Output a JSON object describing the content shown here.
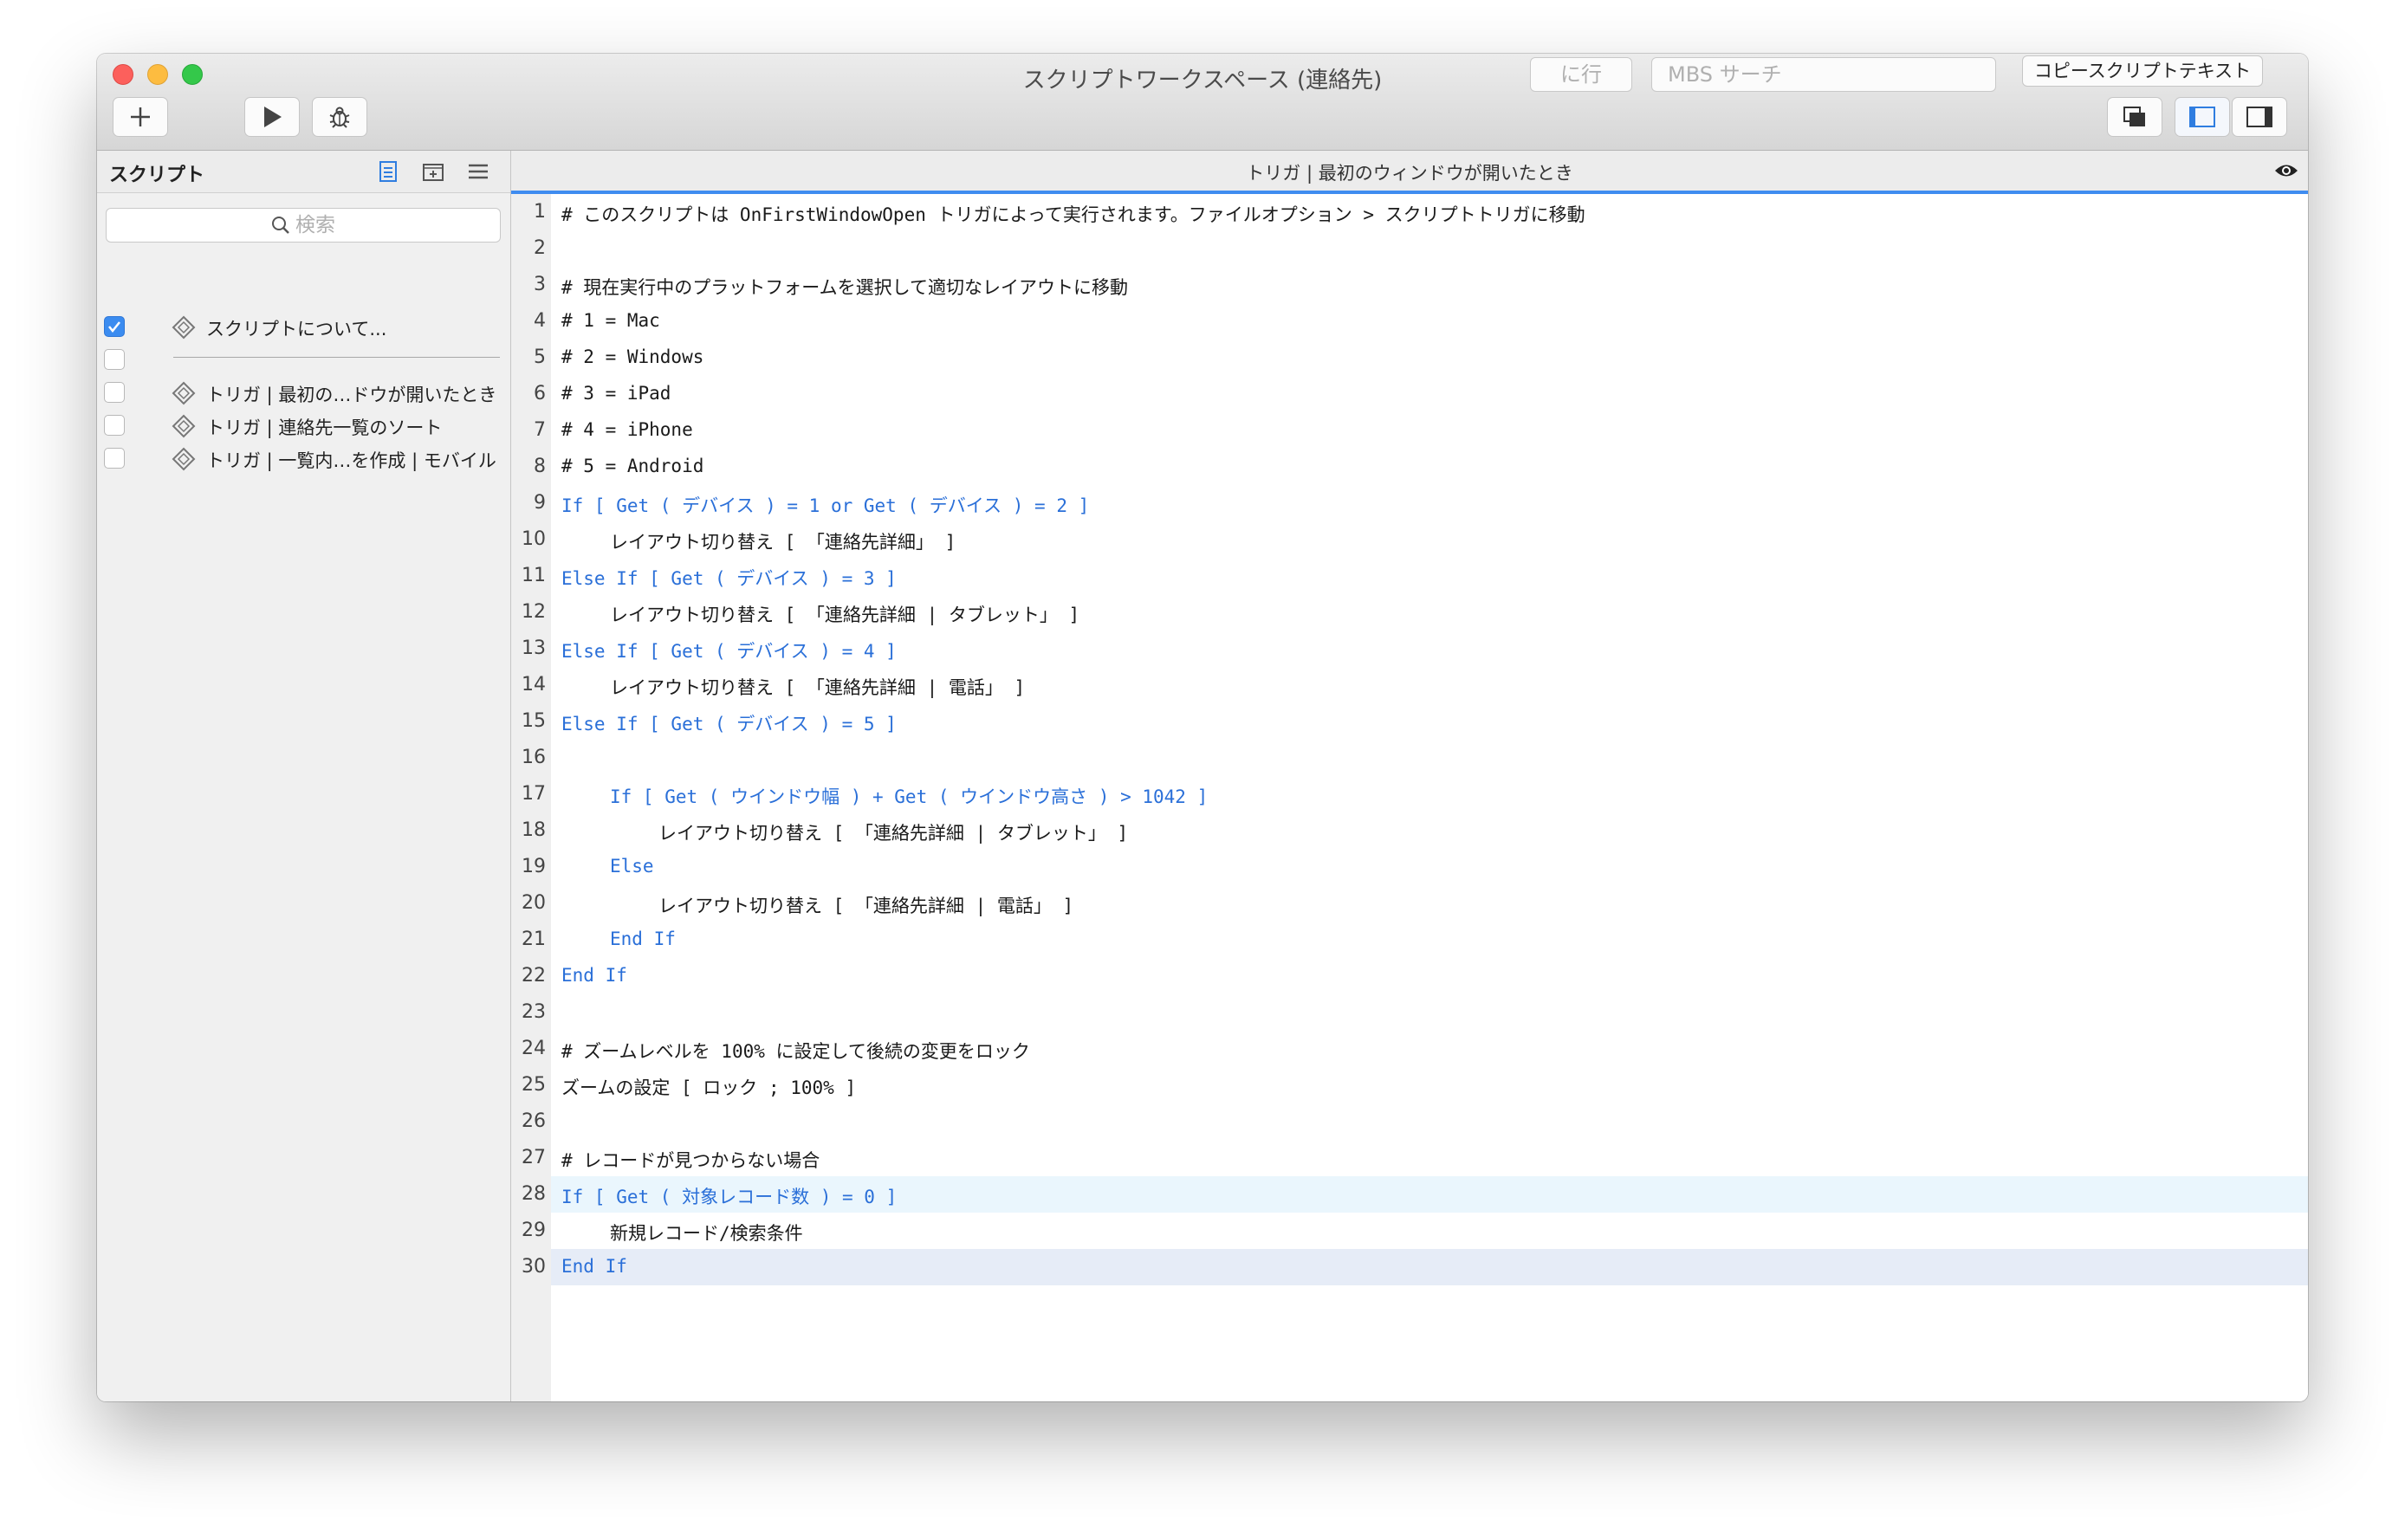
{
  "window": {
    "title": "スクリプトワークスペース (連絡先)"
  },
  "toolbar": {
    "goto_placeholder": "に行",
    "search_placeholder": "MBS サーチ",
    "copy_button_label": "コピースクリプトテキスト"
  },
  "sidebar": {
    "title": "スクリプト",
    "search_placeholder": "検索",
    "items": [
      {
        "label": "スクリプトについて...",
        "checked": true
      },
      {
        "label": "",
        "checked": false
      },
      {
        "label": "トリガ | 最初の…ドウが開いたとき",
        "checked": false
      },
      {
        "label": "トリガ | 連絡先一覧のソート",
        "checked": false
      },
      {
        "label": "トリガ | 一覧内…を作成 | モバイル",
        "checked": false
      }
    ]
  },
  "editor": {
    "tab_title": "トリガ | 最初のウィンドウが開いたとき",
    "lines": [
      {
        "n": "1",
        "text": "# このスクリプトは OnFirstWindowOpen トリガによって実行されます。ファイルオプション > スクリプトトリガに移動"
      },
      {
        "n": "2",
        "text": ""
      },
      {
        "n": "3",
        "text": "# 現在実行中のプラットフォームを選択して適切なレイアウトに移動"
      },
      {
        "n": "4",
        "text": "# 1 = Mac"
      },
      {
        "n": "5",
        "text": "# 2 = Windows"
      },
      {
        "n": "6",
        "text": "# 3 = iPad"
      },
      {
        "n": "7",
        "text": "# 4 = iPhone"
      },
      {
        "n": "8",
        "text": "# 5 = Android"
      },
      {
        "n": "9",
        "text": "If [ Get ( デバイス ) = 1 or Get ( デバイス ) = 2 ]"
      },
      {
        "n": "10",
        "text": "レイアウト切り替え [ 「連絡先詳細」 ]"
      },
      {
        "n": "11",
        "text": "Else If [ Get ( デバイス ) = 3 ]"
      },
      {
        "n": "12",
        "text": "レイアウト切り替え [ 「連絡先詳細 | タブレット」 ]"
      },
      {
        "n": "13",
        "text": "Else If [ Get ( デバイス ) = 4 ]"
      },
      {
        "n": "14",
        "text": "レイアウト切り替え [ 「連絡先詳細 | 電話」 ]"
      },
      {
        "n": "15",
        "text": "Else If [ Get ( デバイス ) = 5 ]"
      },
      {
        "n": "16",
        "text": ""
      },
      {
        "n": "17",
        "text": "If [ Get ( ウインドウ幅 ) + Get ( ウインドウ高さ ) > 1042 ]"
      },
      {
        "n": "18",
        "text": "レイアウト切り替え [ 「連絡先詳細 | タブレット」 ]"
      },
      {
        "n": "19",
        "text": "Else"
      },
      {
        "n": "20",
        "text": "レイアウト切り替え [ 「連絡先詳細 | 電話」 ]"
      },
      {
        "n": "21",
        "text": "End If"
      },
      {
        "n": "22",
        "text": "End If"
      },
      {
        "n": "23",
        "text": ""
      },
      {
        "n": "24",
        "text": "# ズームレベルを 100% に設定して後続の変更をロック"
      },
      {
        "n": "25",
        "text": "ズームの設定 [ ロック ; 100% ]"
      },
      {
        "n": "26",
        "text": ""
      },
      {
        "n": "27",
        "text": "# レコードが見つからない場合"
      },
      {
        "n": "28",
        "text": "If [ Get ( 対象レコード数 ) = 0 ]"
      },
      {
        "n": "29",
        "text": "新規レコード/検索条件"
      },
      {
        "n": "30",
        "text": "End If"
      }
    ]
  },
  "colors": {
    "accent": "#3f8cf0",
    "keyword": "#2a6fd8",
    "highlight_current": "#eaf6fd",
    "highlight_selected": "#e6ecf7"
  },
  "icons": {
    "close": "traffic-close",
    "minimize": "traffic-minimize",
    "zoom": "traffic-zoom",
    "add": "plus-icon",
    "run": "play-icon",
    "debug": "bug-icon",
    "script_item": "script-diamond-icon",
    "view_toggle": "eye-icon"
  }
}
